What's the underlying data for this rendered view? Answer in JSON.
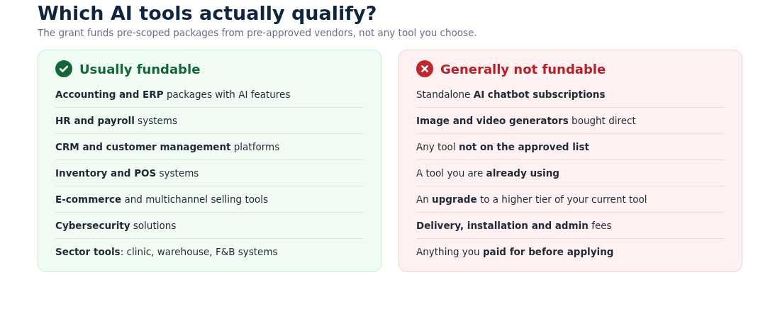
{
  "heading": "Which AI tools actually qualify?",
  "subtitle": "The grant funds pre-scoped packages from pre-approved vendors, not any tool you choose.",
  "cards": [
    {
      "kind": "yes",
      "title": "Usually fundable",
      "items": [
        "**Accounting and ERP** packages with AI features",
        "**HR and payroll** systems",
        "**CRM and customer management** platforms",
        "**Inventory and POS** systems",
        "**E-commerce** and multichannel selling tools",
        "**Cybersecurity** solutions",
        "**Sector tools**: clinic, warehouse, F&B systems"
      ]
    },
    {
      "kind": "no",
      "title": "Generally not fundable",
      "items": [
        "Standalone **AI chatbot subscriptions**",
        "**Image and video generators** bought direct",
        "Any tool **not on the approved list**",
        "A tool you are **already using**",
        "An **upgrade** to a higher tier of your current tool",
        "**Delivery, installation and admin** fees",
        "Anything you **paid for before applying**"
      ]
    }
  ]
}
